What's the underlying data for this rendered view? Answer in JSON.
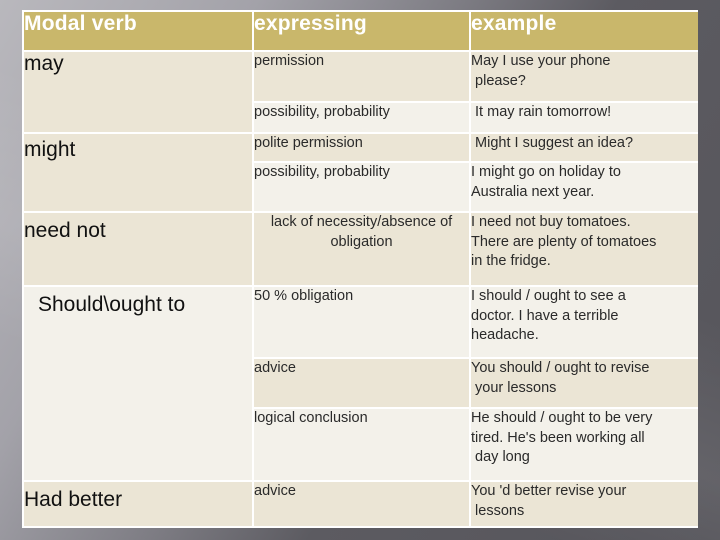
{
  "slide": {
    "colors": {
      "header_bg": "#c9b76b",
      "header_text": "#ffffff",
      "row_dark": "#ebe5d5",
      "row_light": "#f3f1ea",
      "background": "#5c5b61"
    }
  },
  "table": {
    "headers": [
      "Modal verb",
      "expressing",
      "example"
    ],
    "groups": [
      {
        "verb": "may",
        "rows": [
          {
            "expressing": "permission",
            "example": "May I use your phone\n please?"
          },
          {
            "expressing": "possibility, probability",
            "example": " It may rain tomorrow!"
          }
        ]
      },
      {
        "verb": "might",
        "rows": [
          {
            "expressing": "polite permission",
            "example": " Might I suggest an idea?"
          },
          {
            "expressing": "possibility, probability",
            "example": "I might go on holiday to\nAustralia next year."
          }
        ]
      },
      {
        "verb": "need not",
        "rows": [
          {
            "expressing": "lack of necessity/absence of obligation",
            "example": "I need not buy tomatoes.\nThere are plenty of tomatoes\nin the fridge."
          }
        ]
      },
      {
        "verb": "Should\\ought to",
        "rows": [
          {
            "expressing": "50 % obligation",
            "example": "I should / ought to see a\ndoctor. I have a terrible\nheadache."
          },
          {
            "expressing": "advice",
            "example": "You should / ought to revise\n your lessons"
          },
          {
            "expressing": "logical conclusion",
            "example": "He should / ought to be very\ntired. He's been working all\n day long"
          }
        ]
      },
      {
        "verb": "Had better",
        "rows": [
          {
            "expressing": "advice",
            "example": "You 'd better revise your\n lessons"
          }
        ]
      }
    ]
  }
}
